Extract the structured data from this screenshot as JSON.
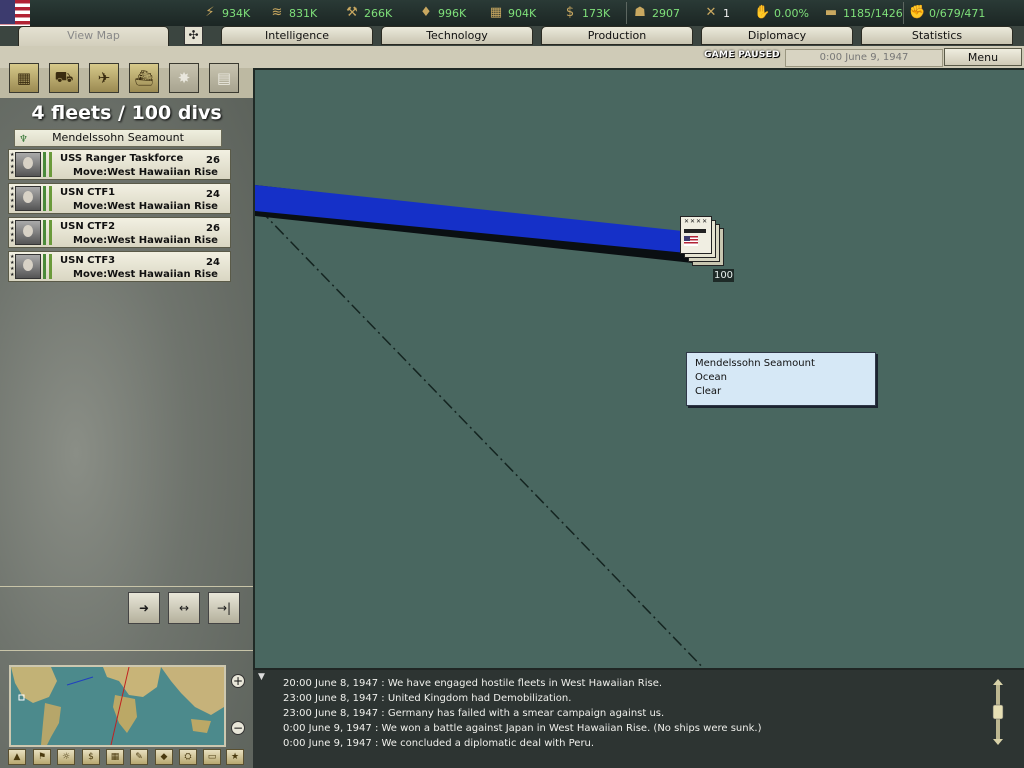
{
  "resources": [
    {
      "icon": "energy-icon",
      "glyph": "⚡",
      "value": "934K"
    },
    {
      "icon": "metal-icon",
      "glyph": "≋",
      "value": "831K"
    },
    {
      "icon": "rare-materials-icon",
      "glyph": "⚒",
      "value": "266K"
    },
    {
      "icon": "oil-icon",
      "glyph": "💧",
      "value": "996K"
    },
    {
      "icon": "supplies-icon",
      "glyph": "▦",
      "value": "904K"
    },
    {
      "icon": "money-icon",
      "glyph": "$",
      "value": "173K"
    },
    {
      "icon": "manpower-icon",
      "glyph": "👥",
      "value": "2907"
    },
    {
      "icon": "diplomats-icon",
      "glyph": "✕",
      "value": "1"
    },
    {
      "icon": "dissent-icon",
      "glyph": "✋",
      "value": "0.00%"
    },
    {
      "icon": "transports-icon",
      "glyph": "▬",
      "value": "1185/1426"
    },
    {
      "icon": "nuke-icon",
      "glyph": "✊",
      "value": "0/679/471"
    }
  ],
  "tabs": [
    "View Map",
    "Intelligence",
    "Technology",
    "Production",
    "Diplomacy",
    "Statistics"
  ],
  "status": {
    "paused": "GAME PAUSED",
    "date": "0:00 June 9, 1947",
    "menu": "Menu"
  },
  "left": {
    "count": "4 fleets / 100 divs",
    "province": "Mendelssohn Seamount",
    "fleets": [
      {
        "name": "USS Ranger Taskforce",
        "num": "26",
        "move": "Move:West Hawaiian Rise"
      },
      {
        "name": "USN CTF1",
        "num": "24",
        "move": "Move:West Hawaiian Rise"
      },
      {
        "name": "USN CTF2",
        "num": "26",
        "move": "Move:West Hawaiian Rise"
      },
      {
        "name": "USN CTF3",
        "num": "24",
        "move": "Move:West Hawaiian Rise"
      }
    ]
  },
  "map": {
    "tooltip": [
      "Mendelssohn Seamount",
      "Ocean",
      "Clear"
    ],
    "stack_count": "100"
  },
  "log": [
    "20:00 June 8, 1947 : We have engaged hostile fleets in West Hawaiian Rise.",
    "23:00 June 8, 1947 : United Kingdom had Demobilization.",
    "23:00 June 8, 1947 : Germany has failed with a smear campaign against us.",
    "0:00 June 9, 1947 : We won a battle against Japan in West Hawaiian Rise. (No ships were sunk.)",
    "0:00 June 9, 1947 : We concluded a diplomatic deal with Peru."
  ],
  "colors": {
    "route": "#1530c8",
    "ocean": "#496760",
    "resource_text": "#7fe07a"
  }
}
